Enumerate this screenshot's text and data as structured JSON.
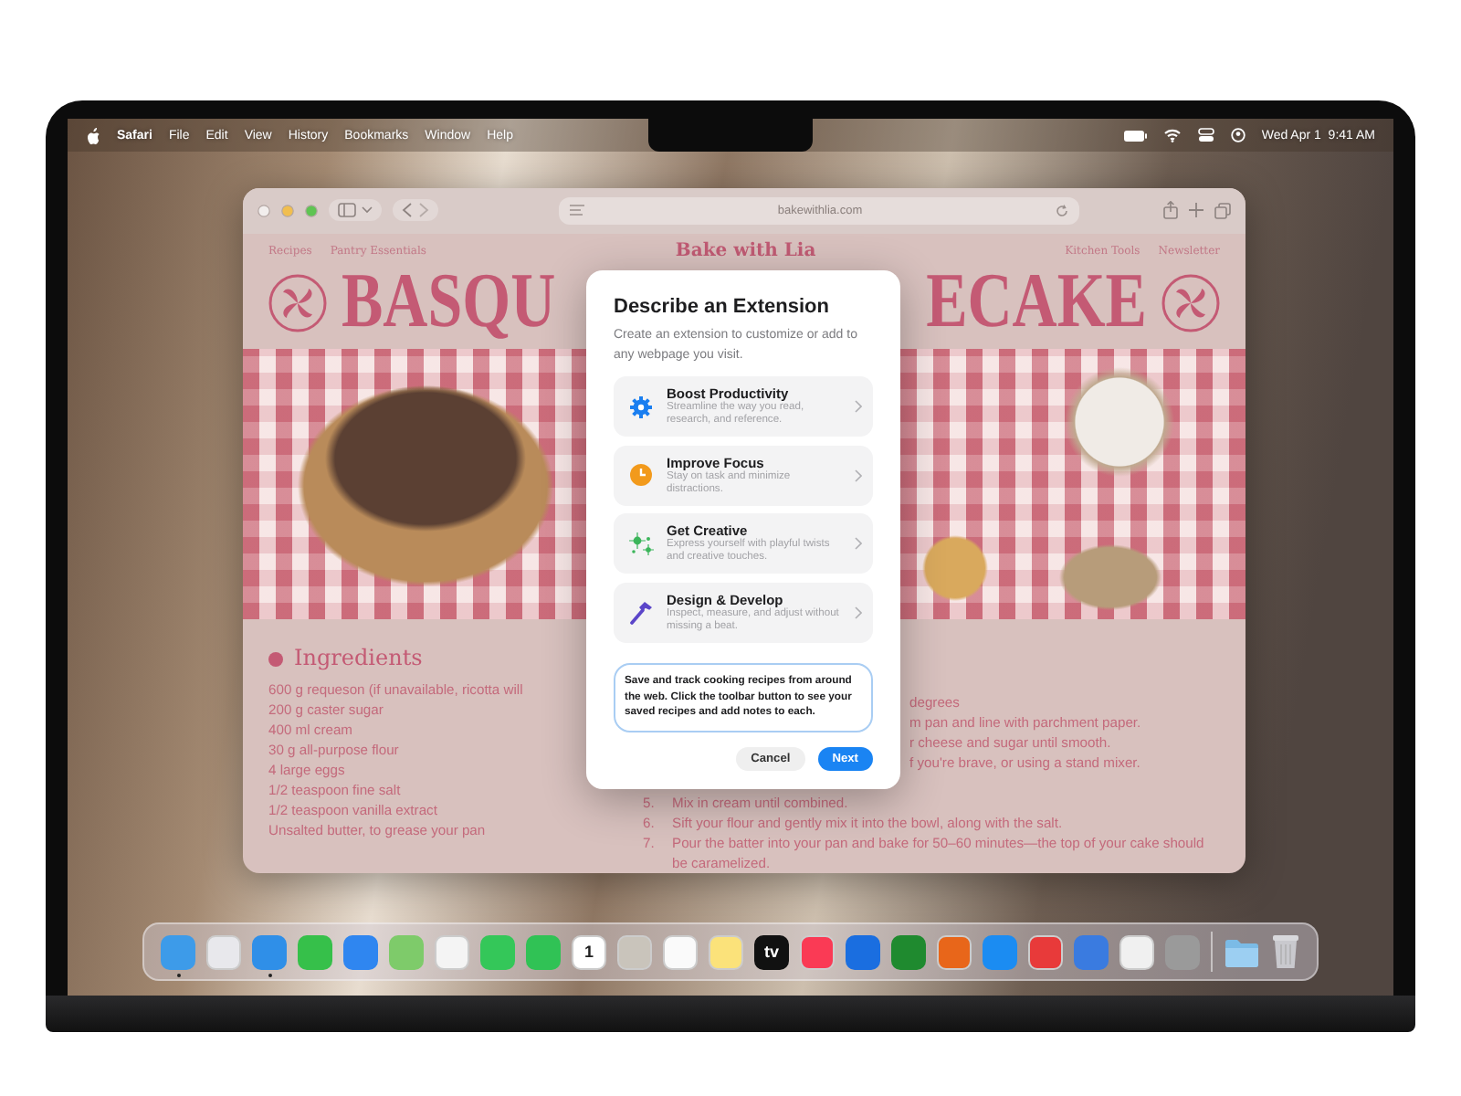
{
  "menubar": {
    "app": "Safari",
    "menus": [
      "File",
      "Edit",
      "View",
      "History",
      "Bookmarks",
      "Window",
      "Help"
    ],
    "clock": "Wed Apr 1  9:41 AM"
  },
  "browser": {
    "url": "bakewithlia.com",
    "site": {
      "nav_left": [
        "Recipes",
        "Pantry Essentials"
      ],
      "brand": "Bake with Lia",
      "nav_right": [
        "Kitchen Tools",
        "Newsletter"
      ],
      "title_left": "BASQU",
      "title_right": "ECAKE",
      "ingredients_heading": "Ingredients",
      "ingredients": [
        "600 g requeson (if unavailable, ricotta will",
        "200 g caster sugar",
        "400 ml cream",
        "30 g all-purpose flour",
        "4 large eggs",
        "1/2 teaspoon fine salt",
        "1/2 teaspoon vanilla extract",
        "Unsalted butter, to grease your pan"
      ],
      "steps": [
        {
          "text": "degrees"
        },
        {
          "text": "m pan and line with parchment paper."
        },
        {
          "text": "r cheese and sugar until smooth."
        },
        {
          "text": "f you're brave, or using a stand mixer."
        },
        {
          "number": "5.",
          "text": "Mix in cream until combined."
        },
        {
          "number": "6.",
          "text": "Sift your flour and gently mix it into the bowl, along with the salt."
        },
        {
          "number": "7.",
          "text": "Pour the batter into your pan and bake for 50–60 minutes—the top of your cake should be caramelized."
        }
      ]
    }
  },
  "dialog": {
    "title": "Describe an Extension",
    "subtitle": "Create an extension to customize or add to any webpage you visit.",
    "options": [
      {
        "kind": "productivity",
        "title": "Boost Productivity",
        "description": "Streamline the way you read, research, and reference."
      },
      {
        "kind": "focus",
        "title": "Improve Focus",
        "description": "Stay on task and minimize distractions."
      },
      {
        "kind": "creative",
        "title": "Get Creative",
        "description": "Express yourself with playful twists and creative touches."
      },
      {
        "kind": "develop",
        "title": "Design & Develop",
        "description": "Inspect, measure, and adjust without missing a beat."
      }
    ],
    "prompt_text": "Save and track cooking recipes from around the web. Click the toolbar button to see your saved recipes and add notes to each.",
    "buttons": [
      {
        "label": "Cancel",
        "primary": false
      },
      {
        "label": "Next",
        "primary": true
      }
    ]
  },
  "dock": {
    "apps": [
      {
        "kind": "app",
        "color": "#3d9be9",
        "running": true
      },
      {
        "kind": "app",
        "color": "#e8e8ec",
        "running": false
      },
      {
        "kind": "app",
        "color": "#2f8fe8",
        "running": true
      },
      {
        "kind": "app",
        "color": "#36c04a",
        "running": false
      },
      {
        "kind": "app",
        "color": "#2f86f0",
        "running": false
      },
      {
        "kind": "app",
        "color": "#7ecb6a",
        "running": false
      },
      {
        "kind": "app",
        "color": "#f4f4f4",
        "running": false
      },
      {
        "kind": "app",
        "color": "#34c759",
        "running": false
      },
      {
        "kind": "app",
        "color": "#30c255",
        "running": false
      },
      {
        "kind": "app",
        "color": "#ffffff",
        "label": "1",
        "running": false
      },
      {
        "kind": "app",
        "color": "#c9c4bb",
        "running": false
      },
      {
        "kind": "app",
        "color": "#fafafa",
        "running": false
      },
      {
        "kind": "app",
        "color": "#fbe27a",
        "running": false
      },
      {
        "kind": "app",
        "color": "#111111",
        "label": "tv",
        "running": false
      },
      {
        "kind": "app",
        "color": "#fa3a55",
        "running": false
      },
      {
        "kind": "app",
        "color": "#1a6ee0",
        "running": false
      },
      {
        "kind": "app",
        "color": "#1f8a2f",
        "running": false
      },
      {
        "kind": "app",
        "color": "#e8661a",
        "running": false
      },
      {
        "kind": "app",
        "color": "#1b8cf2",
        "running": false
      },
      {
        "kind": "app",
        "color": "#e83a3a",
        "running": false
      },
      {
        "kind": "app",
        "color": "#3a7be0",
        "running": false
      },
      {
        "kind": "app",
        "color": "#f0f0f0",
        "running": false
      },
      {
        "kind": "app",
        "color": "#9a9a9a",
        "running": false
      },
      {
        "kind": "folder",
        "running": false
      },
      {
        "kind": "trash",
        "running": false
      }
    ]
  }
}
